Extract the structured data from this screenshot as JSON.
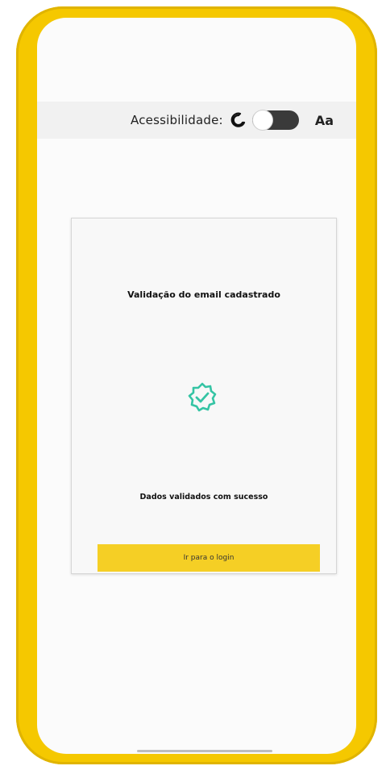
{
  "accessibility": {
    "label": "Acessibilidade:",
    "font_size_label": "Aa",
    "dark_mode_enabled": false
  },
  "card": {
    "title": "Validação do email cadastrado",
    "message": "Dados validados com sucesso",
    "button_label": "Ir para o login"
  },
  "colors": {
    "frame": "#f5c800",
    "button": "#f5cf25",
    "badge": "#35c4a4"
  },
  "icons": {
    "theme": "moon-icon",
    "badge": "verified-badge-icon"
  }
}
